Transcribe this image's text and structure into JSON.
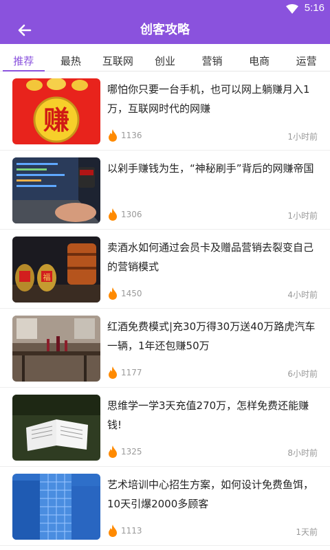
{
  "status": {
    "time": "5:16"
  },
  "appbar": {
    "title": "创客攻略"
  },
  "tabs": [
    {
      "label": "推荐",
      "active": true
    },
    {
      "label": "最热"
    },
    {
      "label": "互联网"
    },
    {
      "label": "创业"
    },
    {
      "label": "营销"
    },
    {
      "label": "电商"
    },
    {
      "label": "运营"
    }
  ],
  "articles": [
    {
      "title": "哪怕你只要一台手机，也可以网上躺赚月入1万，互联网时代的网赚",
      "views": "1136",
      "time": "1小时前",
      "thumb_text": "赚"
    },
    {
      "title": "以剁手赚钱为生，“神秘刷手”背后的网赚帝国",
      "views": "1306",
      "time": "1小时前"
    },
    {
      "title": "卖酒水如何通过会员卡及赠品营销去裂变自己的营销模式",
      "views": "1450",
      "time": "4小时前",
      "thumb_text": "福"
    },
    {
      "title": "红酒免费模式|充30万得30万送40万路虎汽车一辆，1年还包赚50万",
      "views": "1177",
      "time": "6小时前"
    },
    {
      "title": "思维学一学3天充值270万，怎样免费还能赚钱!",
      "views": "1325",
      "time": "8小时前"
    },
    {
      "title": "艺术培训中心招生方案，如何设计免费鱼饵，10天引爆2000多顾客",
      "views": "1113",
      "time": "1天前"
    }
  ],
  "colors": {
    "brand": "#8a52dd",
    "fire": "#ff8a00"
  }
}
